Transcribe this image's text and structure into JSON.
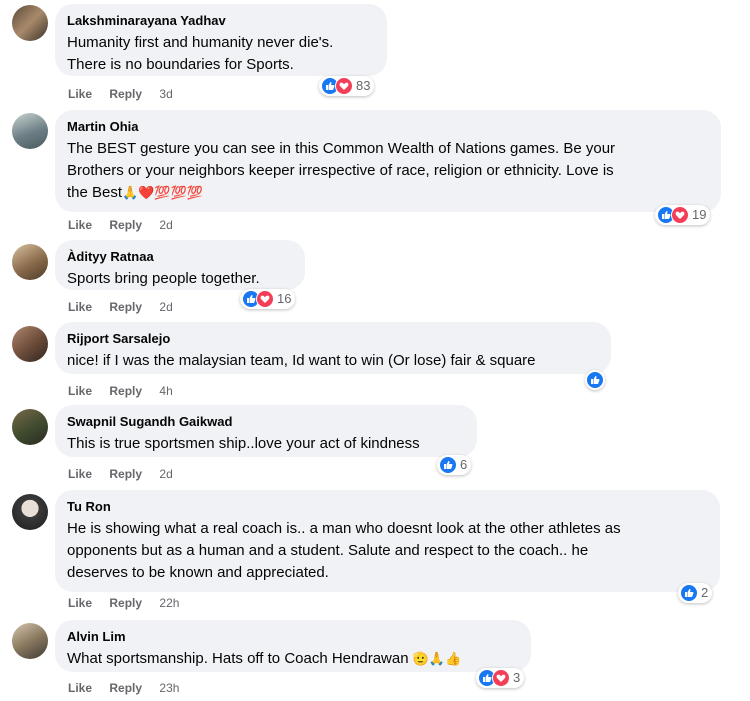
{
  "labels": {
    "like": "Like",
    "reply": "Reply"
  },
  "colors": {
    "like": "#1877f2",
    "love": "#f33e58",
    "bubble": "#f0f2f5",
    "meta": "#65676b"
  },
  "comments": [
    {
      "author": "Lakshminarayana Yadhav",
      "lines": [
        "Humanity first and humanity never die's.",
        "There is no boundaries for Sports."
      ],
      "time": "3d",
      "reactions": [
        "like-icon",
        "love-icon"
      ],
      "count": "83"
    },
    {
      "author": "Martin Ohia",
      "lines": [
        "The BEST gesture you can see in this Common Wealth of Nations games. Be your",
        "Brothers or your neighbors keeper irrespective of race, religion or ethnicity. Love is",
        "the Best"
      ],
      "emojis": "🙏❤️💯💯💯",
      "time": "2d",
      "reactions": [
        "like-icon",
        "love-icon"
      ],
      "count": "19"
    },
    {
      "author": "Àdityy Ratnaa",
      "lines": [
        "Sports bring people together."
      ],
      "time": "2d",
      "reactions": [
        "like-icon",
        "love-icon"
      ],
      "count": "16"
    },
    {
      "author": "Rijport Sarsalejo",
      "lines": [
        "nice! if I was the malaysian team, Id want to win (Or lose) fair & square"
      ],
      "time": "4h",
      "reactions": [
        "like-icon"
      ],
      "count": ""
    },
    {
      "author": "Swapnil Sugandh Gaikwad",
      "lines": [
        "This is true sportsmen ship..love your act of kindness"
      ],
      "time": "2d",
      "reactions": [
        "like-icon"
      ],
      "count": "6"
    },
    {
      "author": "Tu Ron",
      "lines": [
        "He is showing what a real coach is.. a man who doesnt look at the other athletes as",
        "opponents but as a human and a student. Salute and respect to the coach.. he",
        "deserves to be known and appreciated."
      ],
      "time": "22h",
      "reactions": [
        "like-icon"
      ],
      "count": "2"
    },
    {
      "author": "Alvin Lim",
      "lines": [
        "What sportsmanship. Hats off to Coach Hendrawan"
      ],
      "emojis": "🫡🙏👍",
      "time": "23h",
      "reactions": [
        "like-icon",
        "love-icon"
      ],
      "count": "3"
    }
  ]
}
